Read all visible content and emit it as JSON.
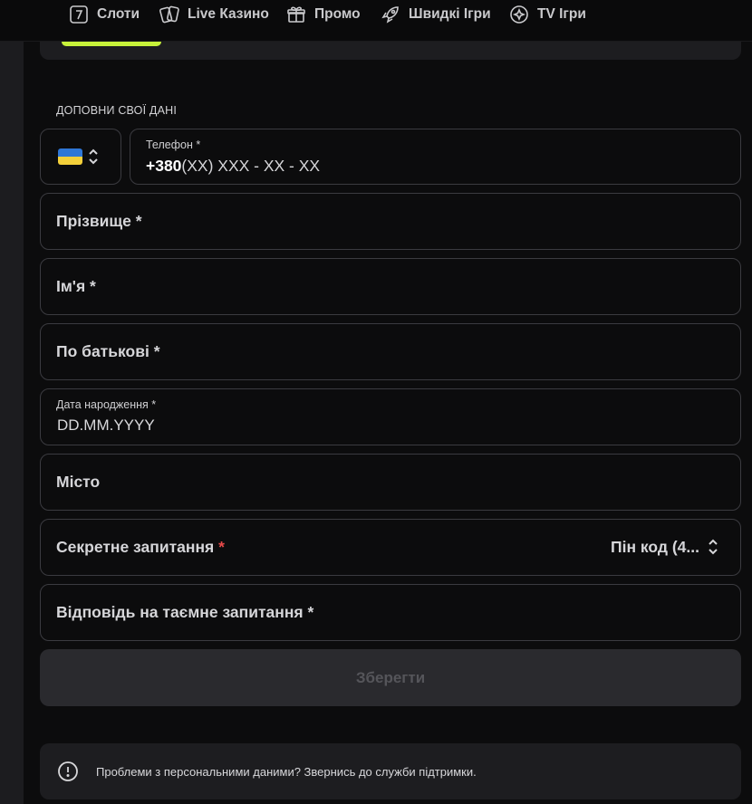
{
  "nav": [
    {
      "label": "Слоти",
      "icon": "slot-seven-icon"
    },
    {
      "label": "Live Казино",
      "icon": "cards-icon"
    },
    {
      "label": "Промо",
      "icon": "gift-icon"
    },
    {
      "label": "Швидкі Ігри",
      "icon": "rocket-icon"
    },
    {
      "label": "TV Ігри",
      "icon": "tv-sparkle-icon"
    }
  ],
  "form": {
    "heading": "ДОПОВНИ СВОЇ ДАНІ",
    "country_flag": "Ukraine",
    "phone": {
      "label": "Телефон *",
      "prefix": "+380",
      "placeholder": "(XX) XXX - XX - XX"
    },
    "surname": {
      "placeholder": "Прізвище *"
    },
    "first_name": {
      "placeholder": "Ім'я *"
    },
    "patronymic": {
      "placeholder": "По батькові *"
    },
    "birth_date": {
      "label": "Дата народження *",
      "value": "DD.MM.YYYY"
    },
    "city": {
      "placeholder": "Місто"
    },
    "secret_question": {
      "label": "Секретне запитання",
      "required_mark": "*",
      "value": "Пін код (4..."
    },
    "secret_answer": {
      "placeholder": "Відповідь на таємне запитання *"
    },
    "save_label": "Зберегти"
  },
  "info": {
    "text": "Проблеми з персональними даними? Звернись до служби підтримки."
  },
  "colors": {
    "accent": "#c7f23a",
    "background": "#0c0c0d",
    "border": "#3b3b40",
    "required": "#e84a4a"
  }
}
